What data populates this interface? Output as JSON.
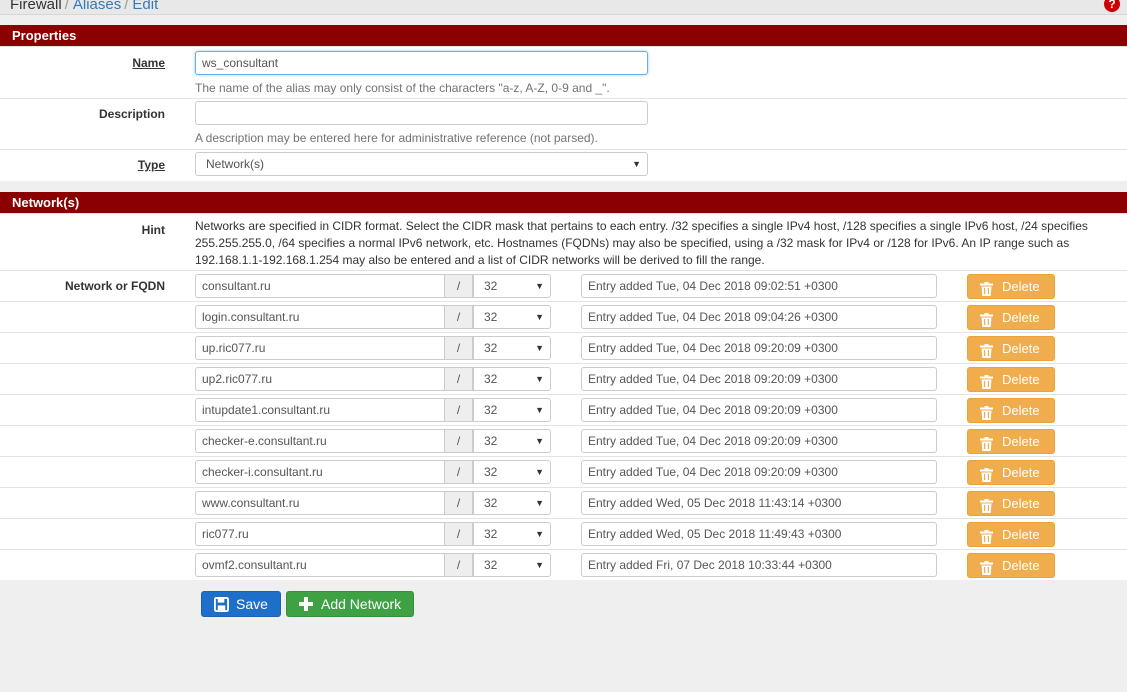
{
  "breadcrumb": {
    "root": "Firewall",
    "section": "Aliases",
    "page": "Edit",
    "separator": "/"
  },
  "help_icon": "?",
  "properties": {
    "heading": "Properties",
    "name_label": "Name",
    "name_value": "ws_consultant",
    "name_help": "The name of the alias may only consist of the characters \"a-z, A-Z, 0-9 and _\".",
    "description_label": "Description",
    "description_value": "",
    "description_help": "A description may be entered here for administrative reference (not parsed).",
    "type_label": "Type",
    "type_value": "Network(s)"
  },
  "networks": {
    "heading": "Network(s)",
    "hint_label": "Hint",
    "hint_text": "Networks are specified in CIDR format. Select the CIDR mask that pertains to each entry. /32 specifies a single IPv4 host, /128 specifies a single IPv6 host, /24 specifies 255.255.255.0, /64 specifies a normal IPv6 network, etc. Hostnames (FQDNs) may also be specified, using a /32 mask for IPv4 or /128 for IPv6. An IP range such as 192.168.1.1-192.168.1.254 may also be entered and a list of CIDR networks will be derived to fill the range.",
    "row_label": "Network or FQDN",
    "slash": "/",
    "delete_label": "Delete",
    "entries": [
      {
        "address": "consultant.ru",
        "mask": "32",
        "description": "Entry added Tue, 04 Dec 2018 09:02:51 +0300"
      },
      {
        "address": "login.consultant.ru",
        "mask": "32",
        "description": "Entry added Tue, 04 Dec 2018 09:04:26 +0300"
      },
      {
        "address": "up.ric077.ru",
        "mask": "32",
        "description": "Entry added Tue, 04 Dec 2018 09:20:09 +0300"
      },
      {
        "address": "up2.ric077.ru",
        "mask": "32",
        "description": "Entry added Tue, 04 Dec 2018 09:20:09 +0300"
      },
      {
        "address": "intupdate1.consultant.ru",
        "mask": "32",
        "description": "Entry added Tue, 04 Dec 2018 09:20:09 +0300"
      },
      {
        "address": "checker-e.consultant.ru",
        "mask": "32",
        "description": "Entry added Tue, 04 Dec 2018 09:20:09 +0300"
      },
      {
        "address": "checker-i.consultant.ru",
        "mask": "32",
        "description": "Entry added Tue, 04 Dec 2018 09:20:09 +0300"
      },
      {
        "address": "www.consultant.ru",
        "mask": "32",
        "description": "Entry added Wed, 05 Dec 2018 11:43:14 +0300"
      },
      {
        "address": "ric077.ru",
        "mask": "32",
        "description": "Entry added Wed, 05 Dec 2018 11:49:43 +0300"
      },
      {
        "address": "ovmf2.consultant.ru",
        "mask": "32",
        "description": "Entry added Fri, 07 Dec 2018 10:33:44 +0300"
      }
    ]
  },
  "actions": {
    "save_label": "Save",
    "add_label": "Add Network"
  },
  "colors": {
    "panel_heading": "#8b0000",
    "delete_button": "#f0ad4e",
    "save_button": "#1e6fc9",
    "add_button": "#3ea245",
    "link": "#337ab7"
  },
  "icons": {
    "save": "floppy-icon",
    "add": "plus-icon",
    "delete": "trash-icon",
    "help": "help-icon"
  }
}
